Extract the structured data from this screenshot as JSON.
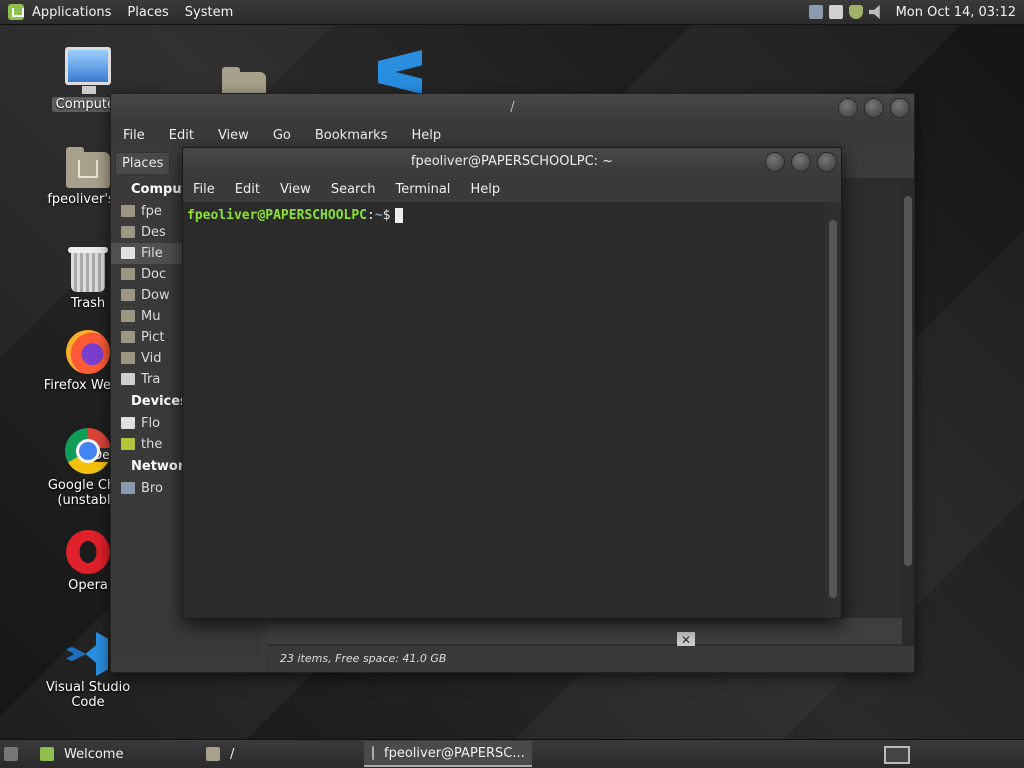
{
  "top_panel": {
    "menus": [
      "Applications",
      "Places",
      "System"
    ],
    "clock": "Mon Oct 14, 03:12"
  },
  "desktop_icons": {
    "computer": "Computer",
    "home": "fpeoliver's H",
    "trash": "Trash",
    "firefox": "Firefox Web B",
    "chrome_line1": "Google Chro",
    "chrome_line2": "(unstable",
    "chrome_badge": "Dev",
    "opera": "Opera",
    "vscode": "Visual Studio Code"
  },
  "file_manager": {
    "title": "/",
    "menu": [
      "File",
      "Edit",
      "View",
      "Go",
      "Bookmarks",
      "Help"
    ],
    "places_label": "Places",
    "sidebar": {
      "computer_head": "Compute",
      "computer_items": [
        "fpe",
        "Des",
        "File",
        "Doc",
        "Dow",
        "Mu",
        "Pict",
        "Vid",
        "Tra"
      ],
      "devices_head": "Devices",
      "device_items": [
        "Flo",
        "the"
      ],
      "network_head": "Network",
      "network_items": [
        "Bro"
      ]
    },
    "status": "23 items, Free space: 41.0 GB",
    "close_glyph": "✕"
  },
  "terminal": {
    "title": "fpeoliver@PAPERSCHOOLPC: ~",
    "menu": [
      "File",
      "Edit",
      "View",
      "Search",
      "Terminal",
      "Help"
    ],
    "prompt_user": "fpeoliver@PAPERSCHOOLPC",
    "prompt_sep": ":",
    "prompt_path": "~",
    "prompt_symbol": "$"
  },
  "bottom_panel": {
    "tasks": [
      "Welcome",
      "/",
      "fpeoliver@PAPERSC..."
    ]
  }
}
